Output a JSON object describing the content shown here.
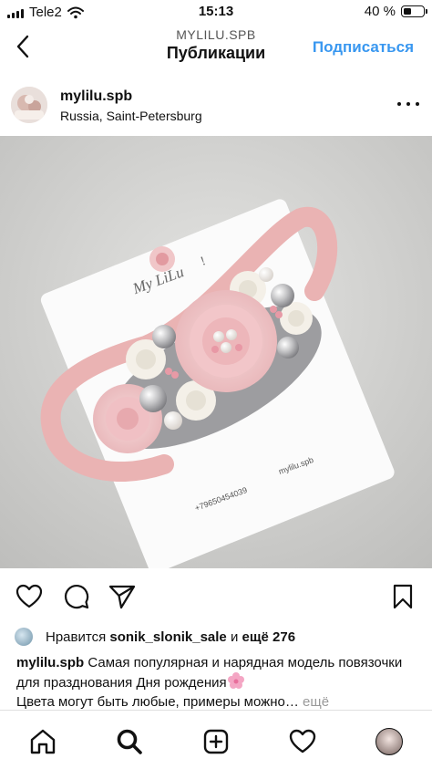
{
  "status": {
    "carrier": "Tele2",
    "time": "15:13",
    "battery": "40 %",
    "battery_level": 0.4
  },
  "nav": {
    "subtitle": "MYLILU.SPB",
    "title": "Публикации",
    "follow_label": "Подписаться",
    "accent": "#3897f0"
  },
  "post": {
    "username": "mylilu.spb",
    "location": "Russia, Saint-Petersburg",
    "card_brand": "My LiLu",
    "card_brand_mark": "!",
    "card_phone": "+79650454039",
    "card_handle": "mylilu.spb"
  },
  "likes": {
    "prefix": "Нравится",
    "user": "sonik_slonik_sale",
    "joiner": "и",
    "count_text": "ещё 276"
  },
  "caption": {
    "username": "mylilu.spb",
    "text_line1": "Самая популярная и нарядная модель повязочки для празднования Дня рождения",
    "text_line2": "Цвета могут быть любые, примеры можно…",
    "more_label": "ещё"
  },
  "icons": {
    "back": "chevron-left-icon",
    "more": "ellipsis-icon",
    "like": "heart-icon",
    "comment": "comment-icon",
    "share": "paper-plane-icon",
    "save": "bookmark-icon",
    "home": "home-icon",
    "search": "search-icon",
    "new_post": "plus-square-icon",
    "activity": "heart-icon",
    "profile": "profile-avatar"
  }
}
